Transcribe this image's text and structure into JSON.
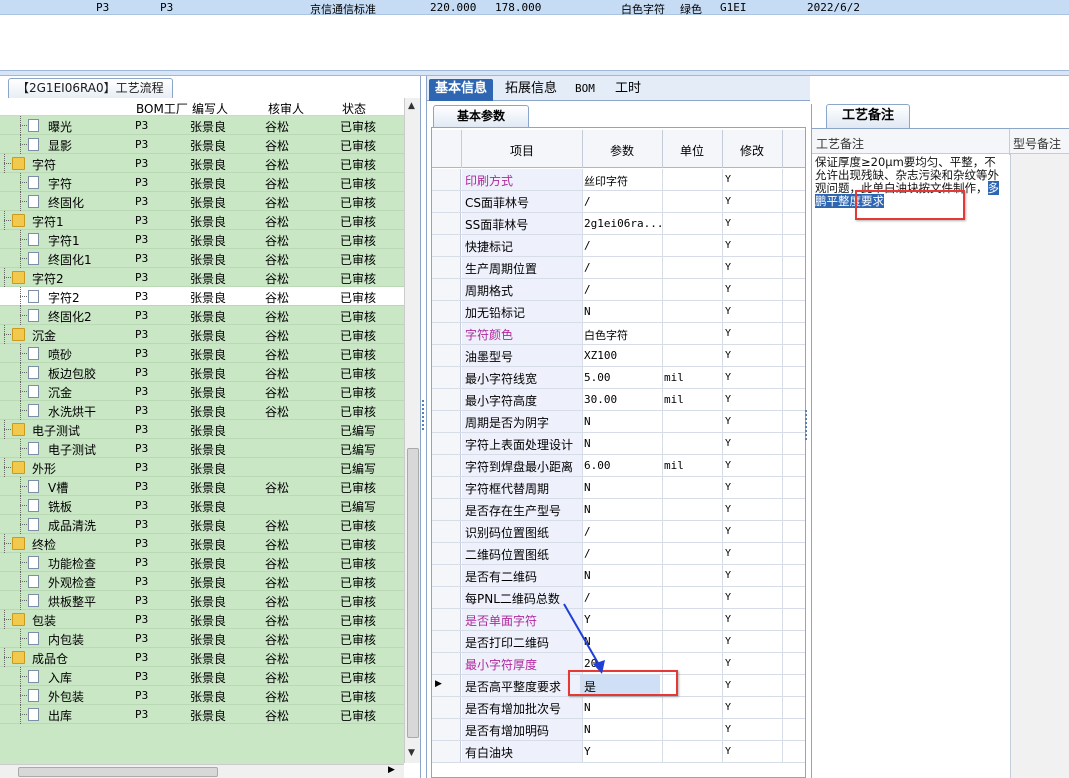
{
  "top_row": {
    "col_a": "P3",
    "col_b": "P3",
    "standard": "京信通信标准",
    "val1": "220.000",
    "val2": "178.000",
    "char_color": "白色字符",
    "ink_color": "绿色",
    "code": "G1EI",
    "date": "2022/6/2"
  },
  "left_panel": {
    "tab_label": "【2G1EI06RA0】工艺流程",
    "headers": {
      "plant": "BOM工厂",
      "writer": "编写人",
      "checker": "核审人",
      "status": "状态"
    },
    "rows": [
      {
        "name": "曝光",
        "type": "doc",
        "plant": "P3",
        "writer": "张景良",
        "checker": "谷松",
        "status": "已审核"
      },
      {
        "name": "显影",
        "type": "doc",
        "plant": "P3",
        "writer": "张景良",
        "checker": "谷松",
        "status": "已审核"
      },
      {
        "name": "字符",
        "type": "folder",
        "plant": "P3",
        "writer": "张景良",
        "checker": "谷松",
        "status": "已审核"
      },
      {
        "name": "字符",
        "type": "doc",
        "plant": "P3",
        "writer": "张景良",
        "checker": "谷松",
        "status": "已审核"
      },
      {
        "name": "终固化",
        "type": "doc",
        "plant": "P3",
        "writer": "张景良",
        "checker": "谷松",
        "status": "已审核"
      },
      {
        "name": "字符1",
        "type": "folder",
        "plant": "P3",
        "writer": "张景良",
        "checker": "谷松",
        "status": "已审核"
      },
      {
        "name": "字符1",
        "type": "doc",
        "plant": "P3",
        "writer": "张景良",
        "checker": "谷松",
        "status": "已审核"
      },
      {
        "name": "终固化1",
        "type": "doc",
        "plant": "P3",
        "writer": "张景良",
        "checker": "谷松",
        "status": "已审核"
      },
      {
        "name": "字符2",
        "type": "folder",
        "plant": "P3",
        "writer": "张景良",
        "checker": "谷松",
        "status": "已审核"
      },
      {
        "name": "字符2",
        "type": "doc",
        "plant": "P3",
        "writer": "张景良",
        "checker": "谷松",
        "status": "已审核",
        "selected": true
      },
      {
        "name": "终固化2",
        "type": "doc",
        "plant": "P3",
        "writer": "张景良",
        "checker": "谷松",
        "status": "已审核"
      },
      {
        "name": "沉金",
        "type": "folder",
        "plant": "P3",
        "writer": "张景良",
        "checker": "谷松",
        "status": "已审核"
      },
      {
        "name": "喷砂",
        "type": "doc",
        "plant": "P3",
        "writer": "张景良",
        "checker": "谷松",
        "status": "已审核"
      },
      {
        "name": "板边包胶",
        "type": "doc",
        "plant": "P3",
        "writer": "张景良",
        "checker": "谷松",
        "status": "已审核"
      },
      {
        "name": "沉金",
        "type": "doc",
        "plant": "P3",
        "writer": "张景良",
        "checker": "谷松",
        "status": "已审核"
      },
      {
        "name": "水洗烘干",
        "type": "doc",
        "plant": "P3",
        "writer": "张景良",
        "checker": "谷松",
        "status": "已审核"
      },
      {
        "name": "电子测试",
        "type": "folder",
        "plant": "P3",
        "writer": "张景良",
        "checker": "",
        "status": "已编写"
      },
      {
        "name": "电子测试",
        "type": "doc",
        "plant": "P3",
        "writer": "张景良",
        "checker": "",
        "status": "已编写"
      },
      {
        "name": "外形",
        "type": "folder",
        "plant": "P3",
        "writer": "张景良",
        "checker": "",
        "status": "已编写"
      },
      {
        "name": "V槽",
        "type": "doc",
        "plant": "P3",
        "writer": "张景良",
        "checker": "谷松",
        "status": "已审核"
      },
      {
        "name": "铣板",
        "type": "doc",
        "plant": "P3",
        "writer": "张景良",
        "checker": "",
        "status": "已编写"
      },
      {
        "name": "成品清洗",
        "type": "doc",
        "plant": "P3",
        "writer": "张景良",
        "checker": "谷松",
        "status": "已审核"
      },
      {
        "name": "终检",
        "type": "folder",
        "plant": "P3",
        "writer": "张景良",
        "checker": "谷松",
        "status": "已审核"
      },
      {
        "name": "功能检查",
        "type": "doc",
        "plant": "P3",
        "writer": "张景良",
        "checker": "谷松",
        "status": "已审核"
      },
      {
        "name": "外观检查",
        "type": "doc",
        "plant": "P3",
        "writer": "张景良",
        "checker": "谷松",
        "status": "已审核"
      },
      {
        "name": "烘板整平",
        "type": "doc",
        "plant": "P3",
        "writer": "张景良",
        "checker": "谷松",
        "status": "已审核"
      },
      {
        "name": "包装",
        "type": "folder",
        "plant": "P3",
        "writer": "张景良",
        "checker": "谷松",
        "status": "已审核"
      },
      {
        "name": "内包装",
        "type": "doc",
        "plant": "P3",
        "writer": "张景良",
        "checker": "谷松",
        "status": "已审核"
      },
      {
        "name": "成品仓",
        "type": "folder",
        "plant": "P3",
        "writer": "张景良",
        "checker": "谷松",
        "status": "已审核"
      },
      {
        "name": "入库",
        "type": "doc",
        "plant": "P3",
        "writer": "张景良",
        "checker": "谷松",
        "status": "已审核"
      },
      {
        "name": "外包装",
        "type": "doc",
        "plant": "P3",
        "writer": "张景良",
        "checker": "谷松",
        "status": "已审核"
      },
      {
        "name": "出库",
        "type": "doc",
        "plant": "P3",
        "writer": "张景良",
        "checker": "谷松",
        "status": "已审核"
      }
    ]
  },
  "mid_panel": {
    "tabs": [
      "基本信息",
      "拓展信息",
      "BOM",
      "工时"
    ],
    "sub_tab": "基本参数",
    "headers": {
      "item": "项目",
      "value": "参数",
      "unit": "单位",
      "modify": "修改"
    },
    "rows": [
      {
        "item": "印刷方式",
        "value": "丝印字符",
        "unit": "",
        "modify": "Y",
        "purple": true
      },
      {
        "item": "CS面菲林号",
        "value": "/",
        "unit": "",
        "modify": "Y"
      },
      {
        "item": "SS面菲林号",
        "value": "2g1ei06ra...",
        "unit": "",
        "modify": "Y"
      },
      {
        "item": "快捷标记",
        "value": "/",
        "unit": "",
        "modify": "Y"
      },
      {
        "item": "生产周期位置",
        "value": "/",
        "unit": "",
        "modify": "Y"
      },
      {
        "item": "周期格式",
        "value": "/",
        "unit": "",
        "modify": "Y"
      },
      {
        "item": "加无铅标记",
        "value": "N",
        "unit": "",
        "modify": "Y"
      },
      {
        "item": "字符颜色",
        "value": "白色字符",
        "unit": "",
        "modify": "Y",
        "purple": true
      },
      {
        "item": "油墨型号",
        "value": "XZ100",
        "unit": "",
        "modify": "Y"
      },
      {
        "item": "最小字符线宽",
        "value": "5.00",
        "unit": "mil",
        "modify": "Y"
      },
      {
        "item": "最小字符高度",
        "value": "30.00",
        "unit": "mil",
        "modify": "Y"
      },
      {
        "item": "周期是否为阴字",
        "value": "N",
        "unit": "",
        "modify": "Y"
      },
      {
        "item": "字符上表面处理设计",
        "value": "N",
        "unit": "",
        "modify": "Y"
      },
      {
        "item": "字符到焊盘最小距离",
        "value": "6.00",
        "unit": "mil",
        "modify": "Y"
      },
      {
        "item": "字符框代替周期",
        "value": "N",
        "unit": "",
        "modify": "Y"
      },
      {
        "item": "是否存在生产型号",
        "value": "N",
        "unit": "",
        "modify": "Y"
      },
      {
        "item": "识别码位置图纸",
        "value": "/",
        "unit": "",
        "modify": "Y"
      },
      {
        "item": "二维码位置图纸",
        "value": "/",
        "unit": "",
        "modify": "Y"
      },
      {
        "item": "是否有二维码",
        "value": "N",
        "unit": "",
        "modify": "Y"
      },
      {
        "item": "每PNL二维码总数",
        "value": "/",
        "unit": "",
        "modify": "Y"
      },
      {
        "item": "是否单面字符",
        "value": "Y",
        "unit": "",
        "modify": "Y",
        "purple": true
      },
      {
        "item": "是否打印二维码",
        "value": "N",
        "unit": "",
        "modify": "Y"
      },
      {
        "item": "最小字符厚度",
        "value": "20",
        "unit": "",
        "modify": "Y",
        "purple": true
      },
      {
        "item": "是否高平整度要求",
        "value": "是",
        "unit": "",
        "modify": "Y",
        "active": true
      },
      {
        "item": "是否有增加批次号",
        "value": "N",
        "unit": "",
        "modify": "Y"
      },
      {
        "item": "是否有增加明码",
        "value": "N",
        "unit": "",
        "modify": "Y"
      },
      {
        "item": "有白油块",
        "value": "Y",
        "unit": "",
        "modify": "Y"
      }
    ]
  },
  "right_panel": {
    "tab_label": "工艺备注",
    "col1_header": "工艺备注",
    "col2_header": "型号备注",
    "remark_text": "保证厚度≥20μm要均匀、平整，不允许出现残缺、杂志污染和杂纹等外观问题，此单白油块按文件制作，",
    "remark_highlight": "多鹏平整度要求"
  },
  "colors": {
    "tree_bg": "#c9e6c5",
    "active_tab": "#2e66b1",
    "purple_label": "#b0289d",
    "highlight_box": "#e53935",
    "arrow": "#1f3fd6"
  }
}
